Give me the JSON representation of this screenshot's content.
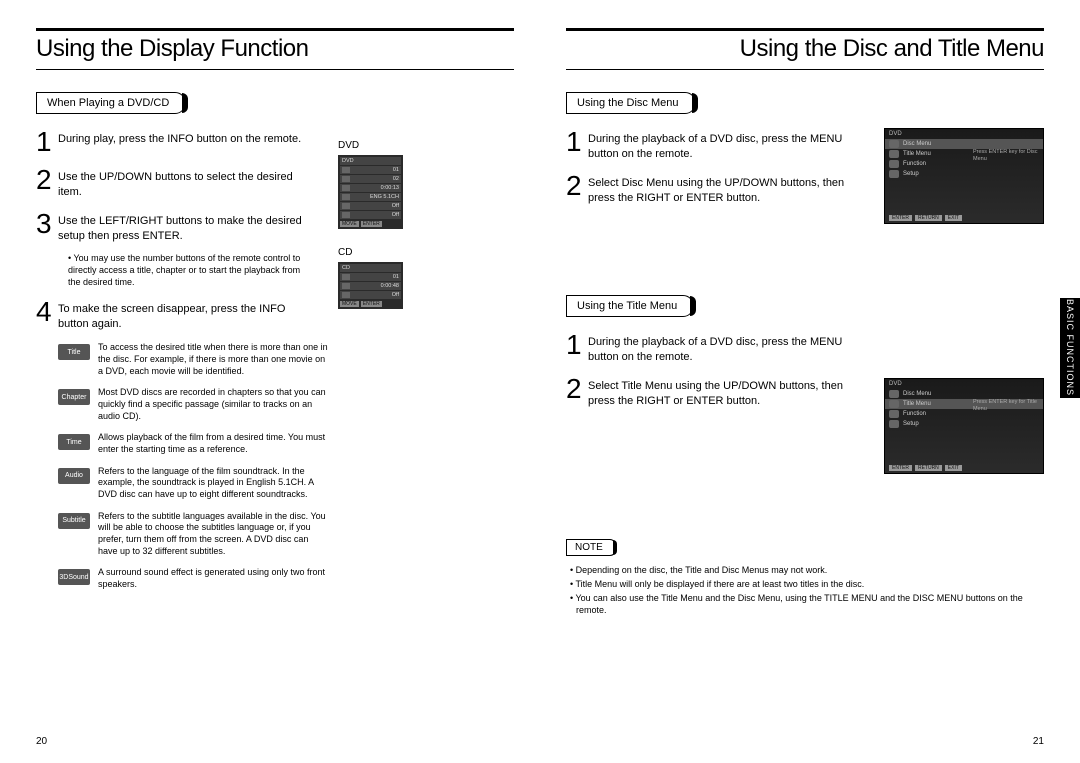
{
  "left": {
    "title": "Using the Display Function",
    "section": "When Playing a DVD/CD",
    "steps": [
      "During play, press the INFO button on the remote.",
      "Use the UP/DOWN buttons to select the desired item.",
      "Use the LEFT/RIGHT buttons to make the desired setup then press ENTER.",
      "To make the screen disappear, press the INFO button again."
    ],
    "step3_note": "• You may use the number buttons of the remote control to directly access a title, chapter or to start the playback from the desired time.",
    "icons": {
      "title": {
        "label": "Title",
        "desc": "To access the desired title when there is more than one in the disc. For example, if there is more than one movie on a DVD, each movie will be identified."
      },
      "chapter": {
        "label": "Chapter",
        "desc": "Most DVD discs are recorded in chapters so that you can quickly find a specific passage (similar to tracks on an audio CD)."
      },
      "time": {
        "label": "Time",
        "desc": "Allows playback of the film from a desired time. You must enter the starting time as a reference."
      },
      "audio": {
        "label": "Audio",
        "desc": "Refers to the language of the film soundtrack. In the example, the soundtrack is played in English 5.1CH. A DVD disc can have up to eight different soundtracks."
      },
      "subtitle": {
        "label": "Subtitle",
        "desc": "Refers to the subtitle languages available in the disc. You will be able to choose the subtitles language or, if you prefer, turn them off from the screen. A DVD disc can have up to 32 different subtitles."
      },
      "sound3d": {
        "label": "3DSound",
        "desc": "A surround sound effect is generated using only two front speakers."
      }
    },
    "fig": {
      "dvd_label": "DVD",
      "cd_label": "CD",
      "dvd_rows": [
        "01",
        "02",
        "0:00:13",
        "ENG 5.1CH",
        "Off",
        "Off"
      ],
      "cd_rows": [
        "01",
        "0:00:48",
        "Off"
      ],
      "osd_caption_dvd": "DVD",
      "osd_caption_cd": "CD",
      "footer_btns": [
        "MOVE",
        "ENTER"
      ]
    },
    "page_num": "20"
  },
  "right": {
    "title": "Using the Disc and Title Menu",
    "section_a": "Using the Disc Menu",
    "steps_a": [
      "During the playback of a DVD disc, press the MENU button on the remote.",
      "Select Disc Menu  using the UP/DOWN buttons, then press the RIGHT or ENTER button."
    ],
    "section_b": "Using the Title Menu",
    "steps_b": [
      "During the playback of a DVD disc, press the MENU button on the remote.",
      "Select Title Menu  using the UP/DOWN buttons, then press the RIGHT or ENTER button."
    ],
    "note_label": "NOTE",
    "notes": [
      "Depending on the disc, the Title and Disc Menus may not work.",
      "Title Menu will only be displayed if there are at least two titles in the disc.",
      "You can also use the Title Menu and the Disc Menu, using the TITLE MENU and the DISC MENU buttons on the remote."
    ],
    "menu_a": {
      "title": "DVD",
      "items": [
        "Disc Menu",
        "Title Menu",
        "Function",
        "Setup"
      ],
      "hint": "Press ENTER key for Disc Menu",
      "footer": [
        "ENTER",
        "RETURN",
        "EXIT"
      ]
    },
    "menu_b": {
      "title": "DVD",
      "items": [
        "Disc Menu",
        "Title Menu",
        "Function",
        "Setup"
      ],
      "hint": "Press ENTER key for Title Menu",
      "footer": [
        "ENTER",
        "RETURN",
        "EXIT"
      ]
    },
    "side_tab": "BASIC FUNCTIONS",
    "page_num": "21"
  }
}
